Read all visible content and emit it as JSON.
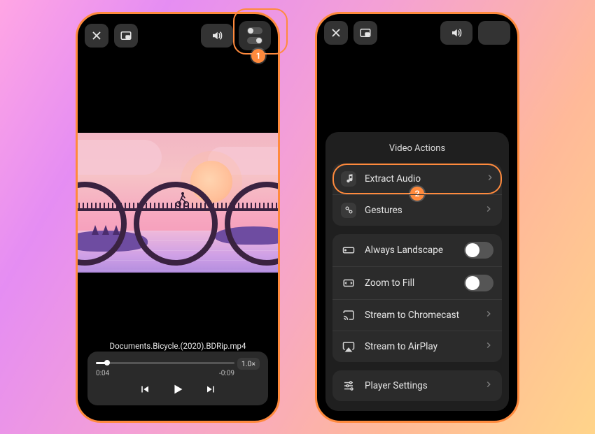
{
  "left": {
    "filename": "Documents.Bicycle.(2020).BDRip.mp4",
    "elapsed": "0:04",
    "remaining": "-0:09",
    "speed": "1.0×"
  },
  "right": {
    "panel_title": "Video Actions",
    "extract_audio": "Extract Audio",
    "gestures": "Gestures",
    "always_landscape": "Always Landscape",
    "zoom_to_fill": "Zoom to Fill",
    "chromecast": "Stream to Chromecast",
    "airplay": "Stream to AirPlay",
    "player_settings": "Player Settings"
  },
  "callouts": {
    "one": "1",
    "two": "2"
  }
}
